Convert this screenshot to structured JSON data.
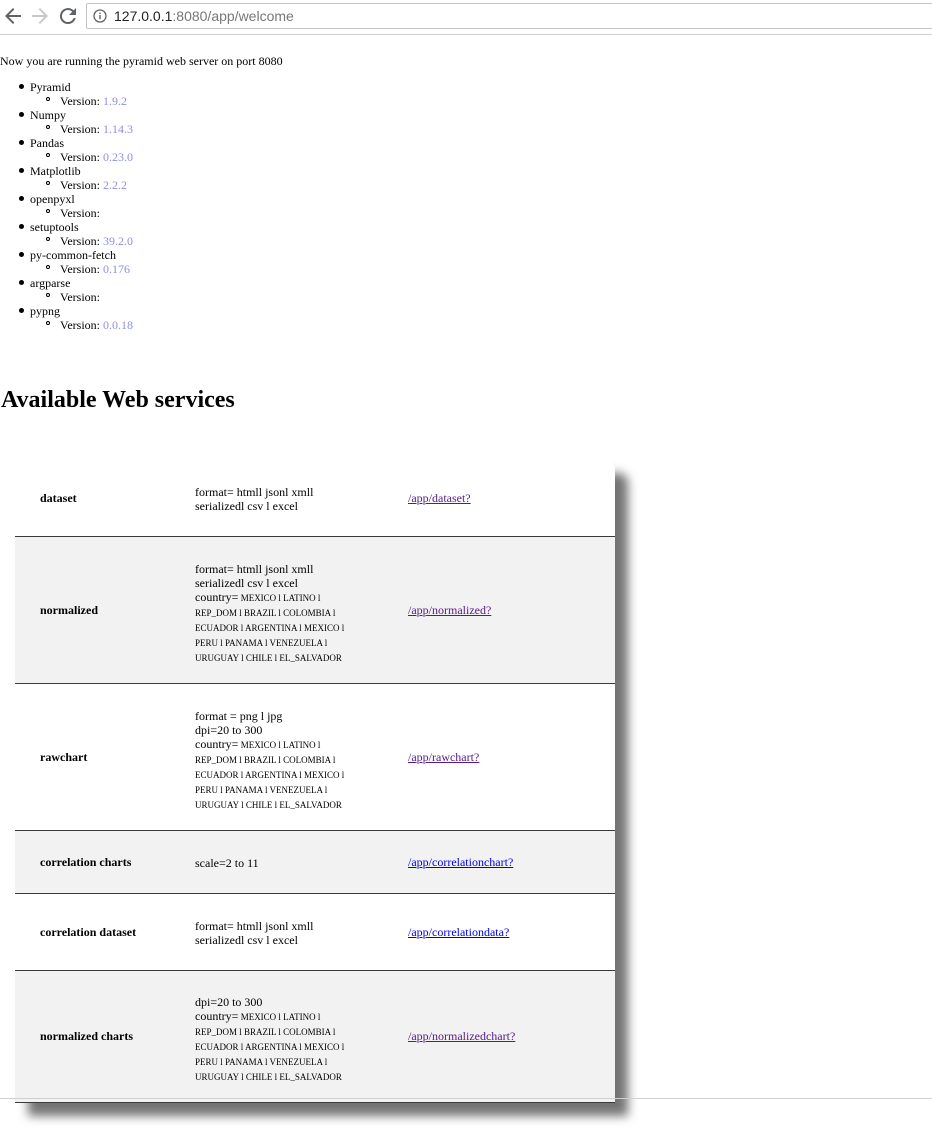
{
  "browser": {
    "url_host": "127.0.0.1",
    "url_rest": ":8080/app/welcome"
  },
  "intro_text": "Now you are running the pyramid web server on port 8080",
  "packages": [
    {
      "name": "Pyramid",
      "version_label": "Version:",
      "version": "1.9.2"
    },
    {
      "name": "Numpy",
      "version_label": "Version:",
      "version": "1.14.3"
    },
    {
      "name": "Pandas",
      "version_label": "Version:",
      "version": "0.23.0"
    },
    {
      "name": "Matplotlib",
      "version_label": "Version:",
      "version": "2.2.2"
    },
    {
      "name": "openpyxl",
      "version_label": "Version:",
      "version": ""
    },
    {
      "name": "setuptools",
      "version_label": "Version:",
      "version": "39.2.0"
    },
    {
      "name": "py-common-fetch",
      "version_label": "Version:",
      "version": "0.176"
    },
    {
      "name": "argparse",
      "version_label": "Version:",
      "version": ""
    },
    {
      "name": "pypng",
      "version_label": "Version:",
      "version": "0.0.18"
    }
  ],
  "services_heading": "Available Web services",
  "services": [
    {
      "name": "dataset",
      "params": [
        {
          "text": "format= htmll jsonl xmll",
          "small": false
        },
        {
          "text": "serializedl csv l excel",
          "small": false
        }
      ],
      "link": "/app/dataset?"
    },
    {
      "name": "normalized",
      "params": [
        {
          "text": "format= htmll jsonl xmll",
          "small": false
        },
        {
          "text": "serializedl csv l excel",
          "small": false
        },
        {
          "text": "country=",
          "small": false,
          "suffix": " MEXICO l LATINO l"
        },
        {
          "text": "REP_DOM l BRAZIL l COLOMBIA l",
          "small": true
        },
        {
          "text": "ECUADOR l ARGENTINA l MEXICO l",
          "small": true
        },
        {
          "text": "PERU l PANAMA l VENEZUELA l",
          "small": true
        },
        {
          "text": "URUGUAY l CHILE l EL_SALVADOR",
          "small": true
        }
      ],
      "link": "/app/normalized?"
    },
    {
      "name": "rawchart",
      "params": [
        {
          "text": "format = png l jpg",
          "small": false
        },
        {
          "text": "dpi=20 to 300",
          "small": false
        },
        {
          "text": "country=",
          "small": false,
          "suffix": " MEXICO l LATINO l"
        },
        {
          "text": "REP_DOM l BRAZIL l COLOMBIA l",
          "small": true
        },
        {
          "text": "ECUADOR l ARGENTINA l MEXICO l",
          "small": true
        },
        {
          "text": "PERU l PANAMA l VENEZUELA l",
          "small": true
        },
        {
          "text": "URUGUAY l CHILE l EL_SALVADOR",
          "small": true
        }
      ],
      "link": "/app/rawchart?"
    },
    {
      "name": "correlation charts",
      "params": [
        {
          "text": "scale=2 to 11",
          "small": false
        }
      ],
      "link": "/app/correlationchart?"
    },
    {
      "name": "correlation dataset",
      "params": [
        {
          "text": "format= htmll jsonl xmll",
          "small": false
        },
        {
          "text": "serializedl csv l excel",
          "small": false
        }
      ],
      "link": "/app/correlationdata?"
    },
    {
      "name": "normalized charts",
      "params": [
        {
          "text": "dpi=20 to 300",
          "small": false
        },
        {
          "text": "country=",
          "small": false,
          "suffix": " MEXICO l LATINO l"
        },
        {
          "text": "REP_DOM l BRAZIL l COLOMBIA l",
          "small": true
        },
        {
          "text": "ECUADOR l ARGENTINA l MEXICO l",
          "small": true
        },
        {
          "text": "PERU l PANAMA l VENEZUELA l",
          "small": true
        },
        {
          "text": "URUGUAY l CHILE l EL_SALVADOR",
          "small": true
        }
      ],
      "link": "/app/normalizedchart?"
    }
  ]
}
